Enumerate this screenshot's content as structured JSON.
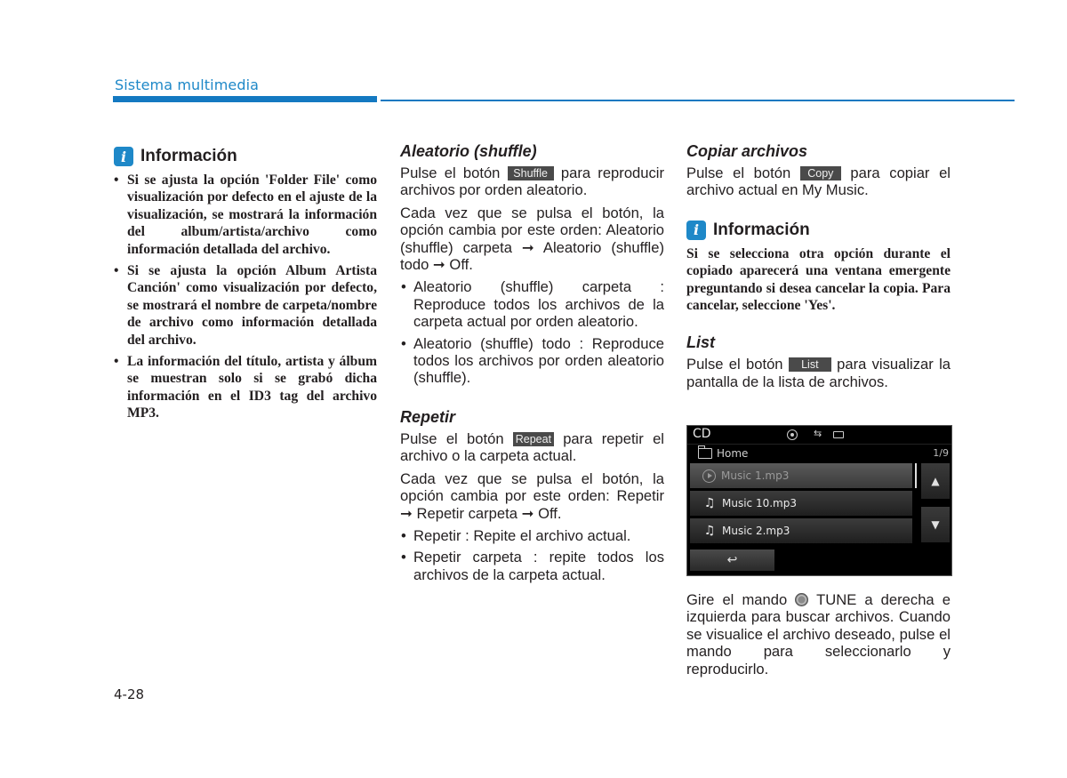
{
  "header": {
    "section_title": "Sistema multimedia",
    "accent_color": "#1479c1"
  },
  "info1": {
    "title": "Información",
    "icon": "info-icon",
    "bullets": [
      "Si se ajusta la opción 'Folder File' como visualización por defecto en el ajuste de la visualización, se mostrará la información del album/artista/archivo como información detallada del archivo.",
      "Si se ajusta la opción Album Artista Canción' como visualización por defecto, se mostrará el nombre de carpeta/nombre de archivo como información detallada del archivo.",
      "La información del título, artista y álbum se muestran solo si se grabó dicha información en el ID3 tag del archivo MP3."
    ]
  },
  "shuffle": {
    "title": "Aleatorio (shuffle)",
    "p1_before": "Pulse el botón ",
    "button": "Shuffle",
    "p1_after": " para reproducir archivos por orden aleatorio.",
    "p2": "Cada vez que se pulsa el botón, la opción cambia por este orden: Aleatorio (shuffle) carpeta ➞ Aleatorio (shuffle) todo ➞ Off.",
    "bullets": [
      "Aleatorio (shuffle) carpeta : Reproduce todos los archivos de la carpeta actual por orden aleatorio.",
      "Aleatorio (shuffle) todo : Reproduce todos los archivos por orden aleatorio (shuffle)."
    ]
  },
  "repeat": {
    "title": "Repetir",
    "p1_before": "Pulse el botón ",
    "button": "Repeat",
    "p1_after": " para repetir el archivo o la carpeta actual.",
    "p2": "Cada vez que se pulsa el botón, la opción cambia por este orden: Repetir ➞ Repetir carpeta ➞ Off.",
    "bullets": [
      "Repetir : Repite el archivo actual.",
      "Repetir carpeta : repite todos los archivos de la carpeta actual."
    ]
  },
  "copy": {
    "title": "Copiar archivos",
    "p1_before": "Pulse el botón ",
    "button": "Copy",
    "p1_after": " para copiar el archivo actual en My Music."
  },
  "info2": {
    "title": "Información",
    "icon": "info-icon",
    "text": "Si se selecciona otra opción durante el copiado aparecerá una ventana emergente preguntando si desea cancelar la copia. Para cancelar, seleccione 'Yes'."
  },
  "list": {
    "title": "List",
    "p1_before": "Pulse el botón ",
    "button": "List",
    "p1_after": " para visualizar la pantalla de la lista de archivos."
  },
  "screen": {
    "source": "CD",
    "status_icons": [
      "disc-icon",
      "usb-icon",
      "battery-icon"
    ],
    "usb_glyph": "⇆",
    "path": "Home",
    "count": "1/9",
    "items": [
      {
        "name": "Music 1.mp3",
        "icon": "play-icon",
        "active": true
      },
      {
        "name": "Music 10.mp3",
        "icon": "music-note-icon",
        "glyph": "♫"
      },
      {
        "name": "Music 2.mp3",
        "icon": "music-note-icon",
        "glyph": "♫"
      }
    ],
    "up_glyph": "▲",
    "down_glyph": "▼",
    "back_glyph": "↩"
  },
  "tune": {
    "before": "Gire el mando ",
    "after": " TUNE a derecha e izquierda para buscar archivos. Cuando se visualice el archivo deseado, pulse el mando para seleccionarlo y reproducirlo."
  },
  "footer": {
    "page_number": "4-28"
  },
  "icons": {
    "info_glyph": "i"
  }
}
